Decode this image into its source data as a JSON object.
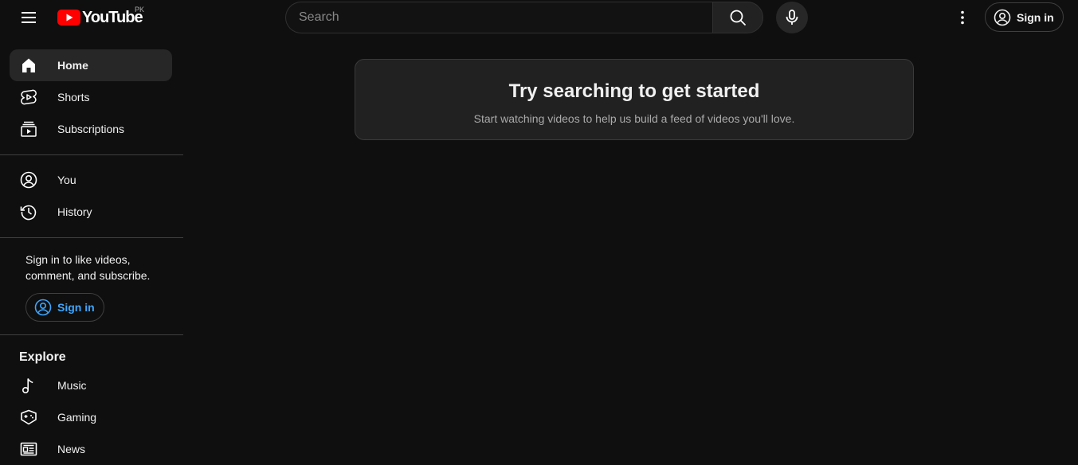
{
  "header": {
    "logo_text": "YouTube",
    "country_code": "PK",
    "search": {
      "placeholder": "Search",
      "value": ""
    },
    "sign_in_label": "Sign in"
  },
  "sidebar": {
    "main": [
      {
        "label": "Home",
        "icon": "home-icon",
        "active": true
      },
      {
        "label": "Shorts",
        "icon": "shorts-icon"
      },
      {
        "label": "Subscriptions",
        "icon": "subscriptions-icon"
      }
    ],
    "you": [
      {
        "label": "You",
        "icon": "account-icon"
      },
      {
        "label": "History",
        "icon": "history-icon"
      }
    ],
    "signin_note": "Sign in to like videos, comment, and subscribe.",
    "sign_in_label": "Sign in",
    "explore": {
      "title": "Explore",
      "items": [
        {
          "label": "Music",
          "icon": "music-icon"
        },
        {
          "label": "Gaming",
          "icon": "gaming-icon"
        },
        {
          "label": "News",
          "icon": "news-icon"
        }
      ]
    }
  },
  "main": {
    "prompt_title": "Try searching to get started",
    "prompt_subtitle": "Start watching videos to help us build a feed of videos you'll love."
  },
  "colors": {
    "background": "#0f0f0f",
    "brand_red": "#ff0000",
    "link_blue": "#3ea6ff",
    "active_item": "#272727"
  }
}
